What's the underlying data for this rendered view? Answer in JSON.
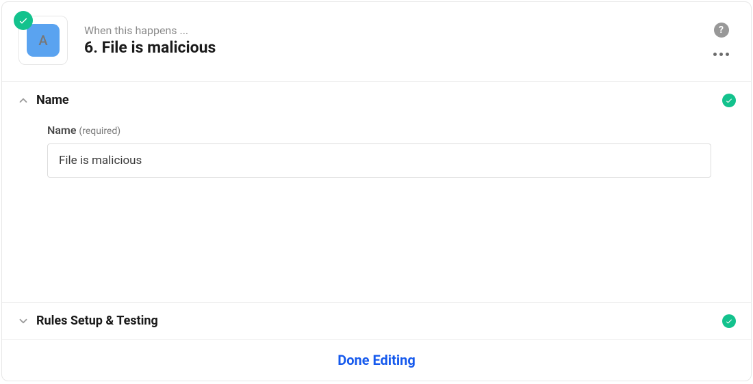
{
  "header": {
    "subtitle": "When this happens ...",
    "title": "6. File is malicious",
    "app_letter": "A"
  },
  "sections": {
    "name": {
      "title": "Name",
      "field_label": "Name",
      "field_required": "(required)",
      "field_value": "File is malicious"
    },
    "rules": {
      "title": "Rules Setup & Testing"
    }
  },
  "footer": {
    "done_label": "Done Editing"
  }
}
